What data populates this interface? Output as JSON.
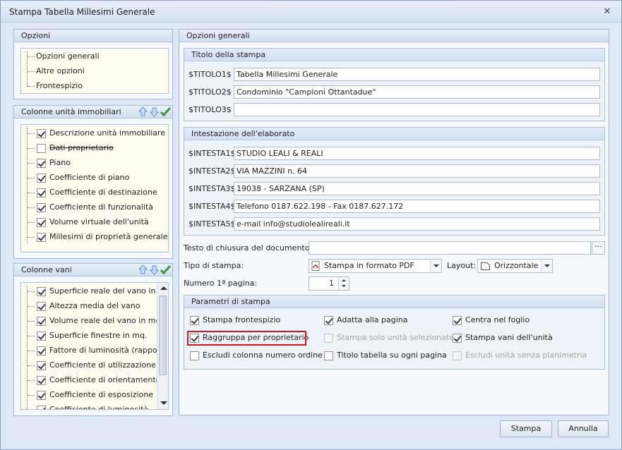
{
  "window": {
    "title": "Stampa Tabella Millesimi Generale"
  },
  "opzioni": {
    "header": "Opzioni",
    "items": [
      "Opzioni generali",
      "Altre opzioni",
      "Frontespizio"
    ]
  },
  "colonne_unita": {
    "header": "Colonne unità immobiliari",
    "items": [
      {
        "label": "Descrizione unità immobiliare",
        "checked": true,
        "strike": false
      },
      {
        "label": "Dati proprietario",
        "checked": false,
        "strike": true
      },
      {
        "label": "Piano",
        "checked": true,
        "strike": false
      },
      {
        "label": "Coefficiente di piano",
        "checked": true,
        "strike": false
      },
      {
        "label": "Coefficiente di destinazione",
        "checked": true,
        "strike": false
      },
      {
        "label": "Coefficiente di funzionalità",
        "checked": true,
        "strike": false
      },
      {
        "label": "Volume virtuale dell'unità",
        "checked": true,
        "strike": false
      },
      {
        "label": "Millesimi di proprietà generale",
        "checked": true,
        "strike": false
      }
    ]
  },
  "colonne_vani": {
    "header": "Colonne vani",
    "items": [
      {
        "label": "Superficie reale del vano in m",
        "checked": true
      },
      {
        "label": "Altezza media del vano",
        "checked": true
      },
      {
        "label": "Volume reale del vano in mc.",
        "checked": true
      },
      {
        "label": "Superficie finestre in mq.",
        "checked": true
      },
      {
        "label": "Fattore di luminosità (rappor",
        "checked": true
      },
      {
        "label": "Coefficiente di utilizzazione",
        "checked": true
      },
      {
        "label": "Coefficiente di orientamento",
        "checked": true
      },
      {
        "label": "Coefficiente di esposizione",
        "checked": true
      },
      {
        "label": "Coefficiente di luminosità",
        "checked": true
      }
    ]
  },
  "opzioni_generali": {
    "header": "Opzioni generali",
    "titolo": {
      "header": "Titolo della stampa",
      "fields": [
        {
          "label": "$TITOLO1$",
          "value": "Tabella Millesimi Generale"
        },
        {
          "label": "$TITOLO2$",
          "value": "Condominio \"Campioni Ottantadue\""
        },
        {
          "label": "$TITOLO3$",
          "value": ""
        }
      ]
    },
    "intestazione": {
      "header": "Intestazione dell'elaborato",
      "fields": [
        {
          "label": "$INTESTA1$",
          "value": "STUDIO LEALI & REALI"
        },
        {
          "label": "$INTESTA2$",
          "value": "VIA MAZZINI n. 64"
        },
        {
          "label": "$INTESTA3$",
          "value": "19038 - SARZANA (SP)"
        },
        {
          "label": "$INTESTA4$",
          "value": "Telefono 0187.622.198 - Fax 0187.627.172"
        },
        {
          "label": "$INTESTA5$",
          "value": "e-mail info@studiolealireali.it"
        }
      ]
    },
    "testo_chiusura": {
      "label": "Testo di chiusura del documento:",
      "value": "",
      "ellipsis": "···"
    },
    "tipo_stampa": {
      "label": "Tipo di stampa:",
      "value": "Stampa in formato PDF"
    },
    "layout": {
      "label": "Layout:",
      "value": "Orizzontale"
    },
    "numero_pagina": {
      "label": "Numero 1ª pagina:",
      "value": "1"
    }
  },
  "parametri": {
    "header": "Parametri di stampa",
    "checks": [
      {
        "label": "Stampa frontespizio",
        "checked": true,
        "enabled": true
      },
      {
        "label": "Adatta alla pagina",
        "checked": true,
        "enabled": true
      },
      {
        "label": "Centra nel foglio",
        "checked": true,
        "enabled": true
      },
      {
        "label": "Raggruppa per proprietario",
        "checked": true,
        "enabled": true
      },
      {
        "label": "Stampa solo unità selezionate",
        "checked": false,
        "enabled": false
      },
      {
        "label": "Stampa vani dell'unità",
        "checked": true,
        "enabled": true
      },
      {
        "label": "Escludi colonna numero ordine",
        "checked": false,
        "enabled": true
      },
      {
        "label": "Titolo tabella su ogni pagina",
        "checked": false,
        "enabled": true
      },
      {
        "label": "Escludi unità senza planimetria",
        "checked": false,
        "enabled": false
      }
    ]
  },
  "buttons": {
    "stampa": "Stampa",
    "annulla": "Annulla"
  },
  "colors": {
    "highlight": "#d6141f",
    "check_green": "#3c9a2a",
    "arrow_blue": "#5b8fd1"
  }
}
